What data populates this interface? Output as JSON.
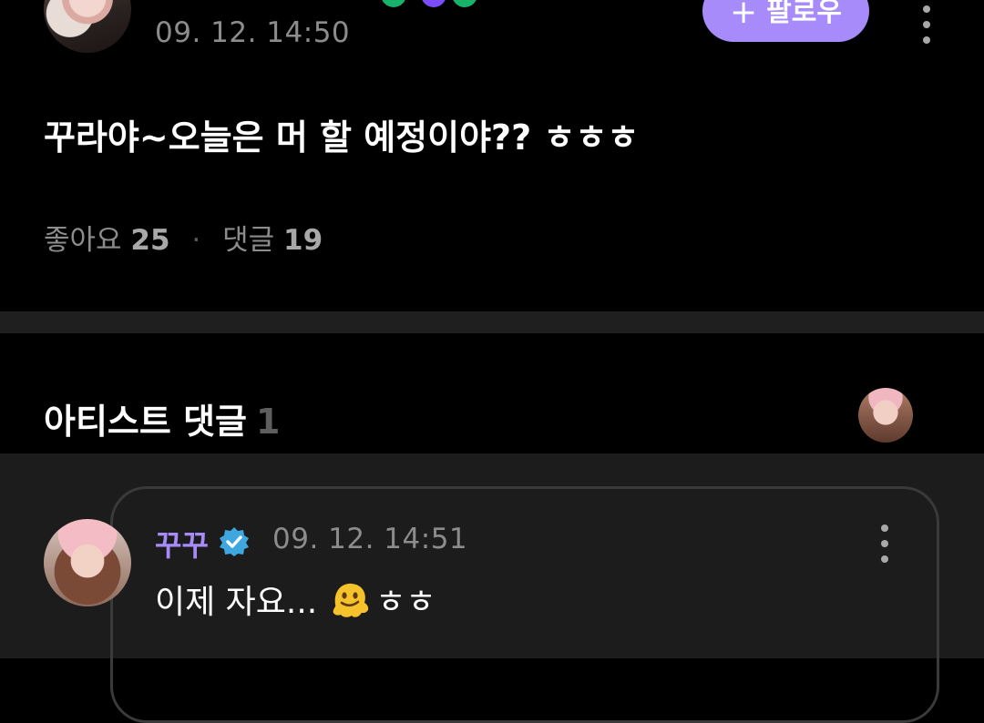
{
  "colors": {
    "background": "#000000",
    "accent_purple": "#a78bfa",
    "muted_text": "#8c8c8c",
    "divider": "#1f1f1f",
    "comment_panel": "#1c1c1c",
    "verified_blue": "#3fa7e0"
  },
  "post": {
    "time": "09. 12. 14:50",
    "follow_label": "팔로우",
    "text": "꾸라야~오늘은 머 할 예정이야?? ㅎㅎㅎ",
    "likes_label": "좋아요",
    "likes_count": "25",
    "comments_label": "댓글",
    "comments_count": "19",
    "icons": [
      "plus-icon",
      "more-vertical-icon"
    ]
  },
  "artist_comments": {
    "title": "아티스트 댓글",
    "count": "1"
  },
  "comment": {
    "author": "꾸꾸",
    "time": "09. 12. 14:51",
    "text_before_emoji": "이제 자요...",
    "emoji": "melting-face-emoji",
    "text_after_emoji": "ㅎㅎ",
    "icons": [
      "verified-badge-icon",
      "more-vertical-icon"
    ]
  }
}
